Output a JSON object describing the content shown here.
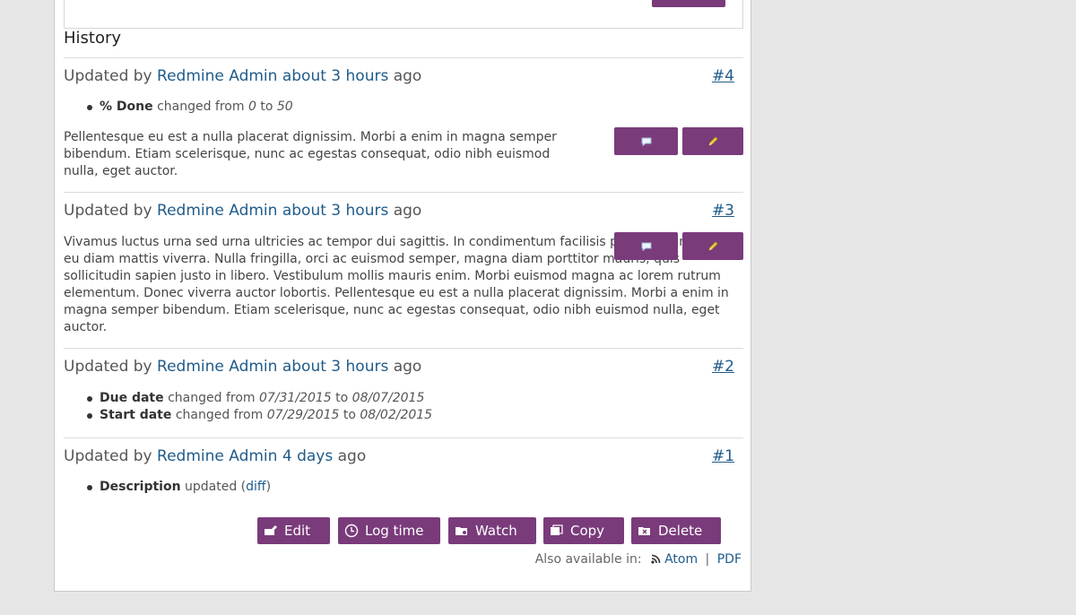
{
  "history": {
    "title": "History"
  },
  "journals": [
    {
      "updated_by_prefix": "Updated by",
      "author": "Redmine Admin",
      "time": "about 3 hours",
      "time_suffix": "ago",
      "number": "#4",
      "details": [
        {
          "field": "% Done",
          "text": "changed from",
          "from": "0",
          "to_word": "to",
          "to": "50"
        }
      ],
      "notes": "Pellentesque eu est a nulla placerat dignissim. Morbi a enim in magna semper bibendum. Etiam scelerisque, nunc ac egestas consequat, odio nibh euismod nulla, eget auctor."
    },
    {
      "updated_by_prefix": "Updated by",
      "author": "Redmine Admin",
      "time": "about 3 hours",
      "time_suffix": "ago",
      "number": "#3",
      "notes": "Vivamus luctus urna sed urna ultricies ac tempor dui sagittis. In condimentum facilisis porta. Sed nec diam eu diam mattis viverra. Nulla fringilla, orci ac euismod semper, magna diam porttitor mauris, quis sollicitudin sapien justo in libero. Vestibulum mollis mauris enim. Morbi euismod magna ac lorem rutrum elementum. Donec viverra auctor lobortis. Pellentesque eu est a nulla placerat dignissim. Morbi a enim in magna semper bibendum. Etiam scelerisque, nunc ac egestas consequat, odio nibh euismod nulla, eget auctor."
    },
    {
      "updated_by_prefix": "Updated by",
      "author": "Redmine Admin",
      "time": "about 3 hours",
      "time_suffix": "ago",
      "number": "#2",
      "details": [
        {
          "field": "Due date",
          "text": "changed from",
          "from": "07/31/2015",
          "to_word": "to",
          "to": "08/07/2015"
        },
        {
          "field": "Start date",
          "text": "changed from",
          "from": "07/29/2015",
          "to_word": "to",
          "to": "08/02/2015"
        }
      ]
    },
    {
      "updated_by_prefix": "Updated by",
      "author": "Redmine Admin",
      "time": "4 days",
      "time_suffix": "ago",
      "number": "#1",
      "details": [
        {
          "field": "Description",
          "text": "updated (",
          "link": "diff",
          "close": ")"
        }
      ]
    }
  ],
  "actions": {
    "edit": "Edit",
    "log_time": "Log time",
    "watch": "Watch",
    "copy": "Copy",
    "delete": "Delete"
  },
  "also_available": {
    "label": "Also available in:",
    "atom": "Atom",
    "separator": "|",
    "pdf": "PDF"
  },
  "icons": {
    "quote": "speech-bubble-icon",
    "edit": "pencil-icon",
    "feed": "rss-icon"
  },
  "colors": {
    "button": "#7a3b7b",
    "link": "#1f5b8a",
    "background": "#e6e6e6"
  }
}
